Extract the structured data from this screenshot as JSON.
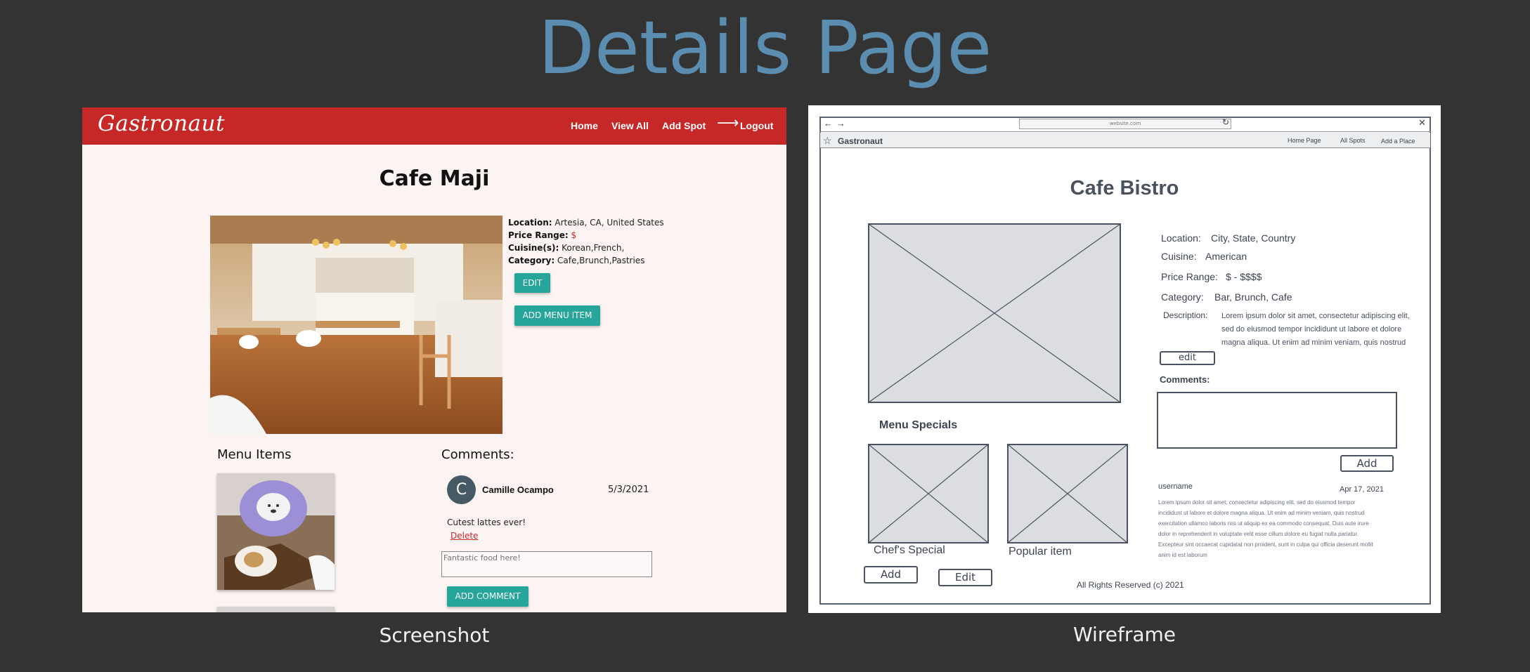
{
  "page_title": "Details Page",
  "captions": {
    "left": "Screenshot",
    "right": "Wireframe"
  },
  "screenshot": {
    "brand": "Gastronaut",
    "nav": {
      "home": "Home",
      "view_all": "View All",
      "add_spot": "Add Spot",
      "logout": "Logout"
    },
    "restaurant_name": "Cafe Maji",
    "info": {
      "location_label": "Location:",
      "location": "Artesia, CA, United States",
      "price_label": "Price Range:",
      "price": "$",
      "cuisine_label": "Cuisine(s):",
      "cuisine": "Korean,French,",
      "category_label": "Category:",
      "category": "Cafe,Brunch,Pastries"
    },
    "edit_button": "EDIT",
    "add_menu_item_button": "ADD MENU ITEM",
    "menu_items_title": "Menu Items",
    "comments_title": "Comments:",
    "comment": {
      "avatar_letter": "C",
      "author": "Camille Ocampo",
      "date": "5/3/2021",
      "text": "Cutest lattes ever!",
      "delete": "Delete"
    },
    "comment_placeholder": "Fantastic food here!",
    "add_comment_button": "ADD COMMENT",
    "colors": {
      "navbar": "#c62828",
      "button": "#26a69a",
      "background": "#fcf4f3"
    }
  },
  "wireframe": {
    "url": "website.com",
    "brand": "Gastronaut",
    "nav": {
      "home": "Home Page",
      "all_spots": "All Spots",
      "add_place": "Add a Place"
    },
    "title": "Cafe Bistro",
    "location_label": "Location:",
    "location": "City, State, Country",
    "cuisine_label": "Cuisine:",
    "cuisine": "American",
    "price_label": "Price Range:",
    "price": "$ - $$$$",
    "category_label": "Category:",
    "category": "Bar, Brunch, Cafe",
    "description_label": "Description:",
    "description_lines": [
      "Lorem ipsum dolor sit amet, consectetur adipiscing elit,",
      "sed do eiusmod tempor incididunt ut labore et dolore",
      "magna aliqua. Ut enim ad minim veniam, quis nostrud"
    ],
    "edit_button": "edit",
    "comments_label": "Comments:",
    "add_button": "Add",
    "username": "username",
    "comment_date": "Apr 17, 2021",
    "comment_lines": [
      "Lorem ipsum dolor sit amet, consectetur adipiscing elit, sed do eiusmod tempor",
      "incididunt ut labore et dolore magna aliqua. Ut enim ad minim veniam, quis nostrud",
      "exercitation ullamco laboris nisi ut aliquip ex ea commodo consequat. Duis aute irure",
      "dolor in reprehenderit in voluptate velit esse cillum dolore eu fugiat nulla pariatur.",
      "Excepteur sint occaecat cupidatat non proident, sunt in culpa qui officia deserunt mollit",
      "anim id est laborum"
    ],
    "menu_specials": "Menu Specials",
    "chefs_special": "Chef's Special",
    "popular_item": "Popular item",
    "menu_add_button": "Add",
    "menu_edit_button": "Edit",
    "footer": "All Rights Reserved (c) 2021"
  }
}
